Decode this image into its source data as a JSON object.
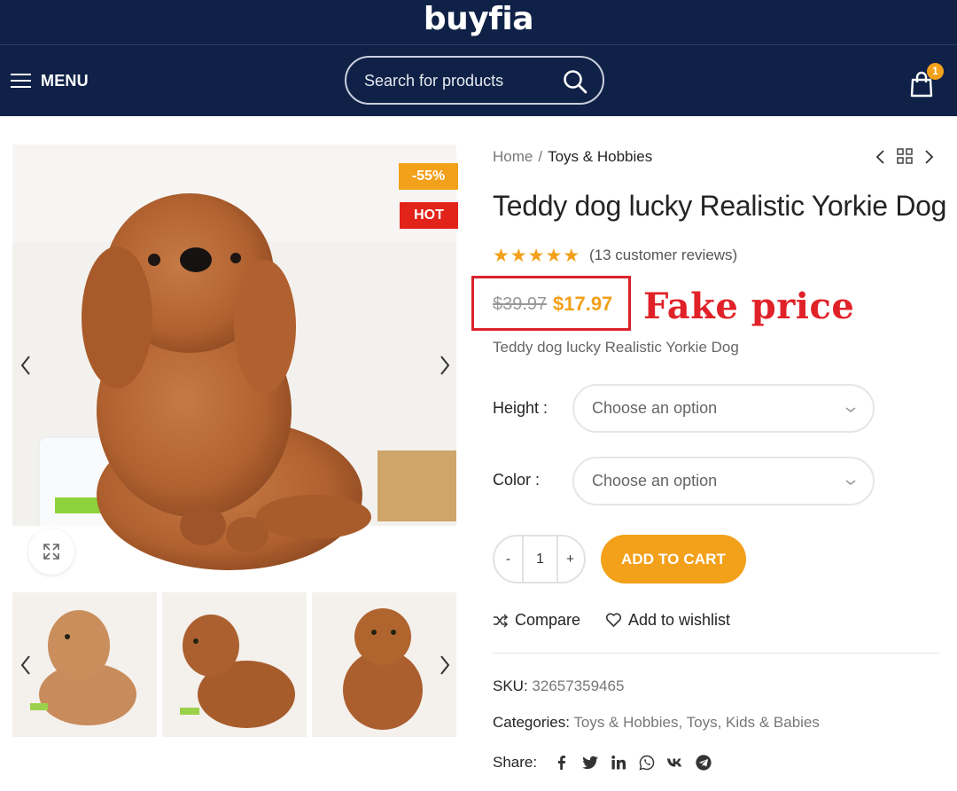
{
  "header": {
    "logo": "buyfia",
    "menu_label": "MENU",
    "search_placeholder": "Search for products",
    "cart_count": "1"
  },
  "gallery": {
    "badge_sale": "-55%",
    "badge_hot": "HOT",
    "thumbnail_count": 3
  },
  "breadcrumb": {
    "home": "Home",
    "separator": "/",
    "current": "Toys & Hobbies"
  },
  "product": {
    "title": "Teddy dog lucky Realistic Yorkie Dog",
    "rating": 5,
    "reviews": "(13 customer reviews)",
    "old_price": "$39.97",
    "new_price": "$17.97",
    "short_description": "Teddy dog lucky Realistic Yorkie Dog"
  },
  "annotation": {
    "label": "Fake price",
    "color": "#e02228"
  },
  "options": {
    "height": {
      "label": "Height :",
      "value": "Choose an option"
    },
    "color": {
      "label": "Color :",
      "value": "Choose an option"
    }
  },
  "cart": {
    "minus": "-",
    "quantity": "1",
    "plus": "+",
    "add_to_cart": "ADD TO CART"
  },
  "actions": {
    "compare": "Compare",
    "wishlist": "Add to wishlist"
  },
  "meta": {
    "sku_label": "SKU:",
    "sku": "32657359465",
    "categories_label": "Categories:",
    "category_1": "Toys & Hobbies",
    "category_sep": ",",
    "category_2": "Toys, Kids & Babies",
    "share_label": "Share:"
  },
  "social_icons": [
    "facebook-icon",
    "twitter-icon",
    "linkedin-icon",
    "whatsapp-icon",
    "vk-icon",
    "telegram-icon"
  ],
  "colors": {
    "navy": "#0f2147",
    "accent": "#f3a01a",
    "hot": "#e2231a"
  }
}
